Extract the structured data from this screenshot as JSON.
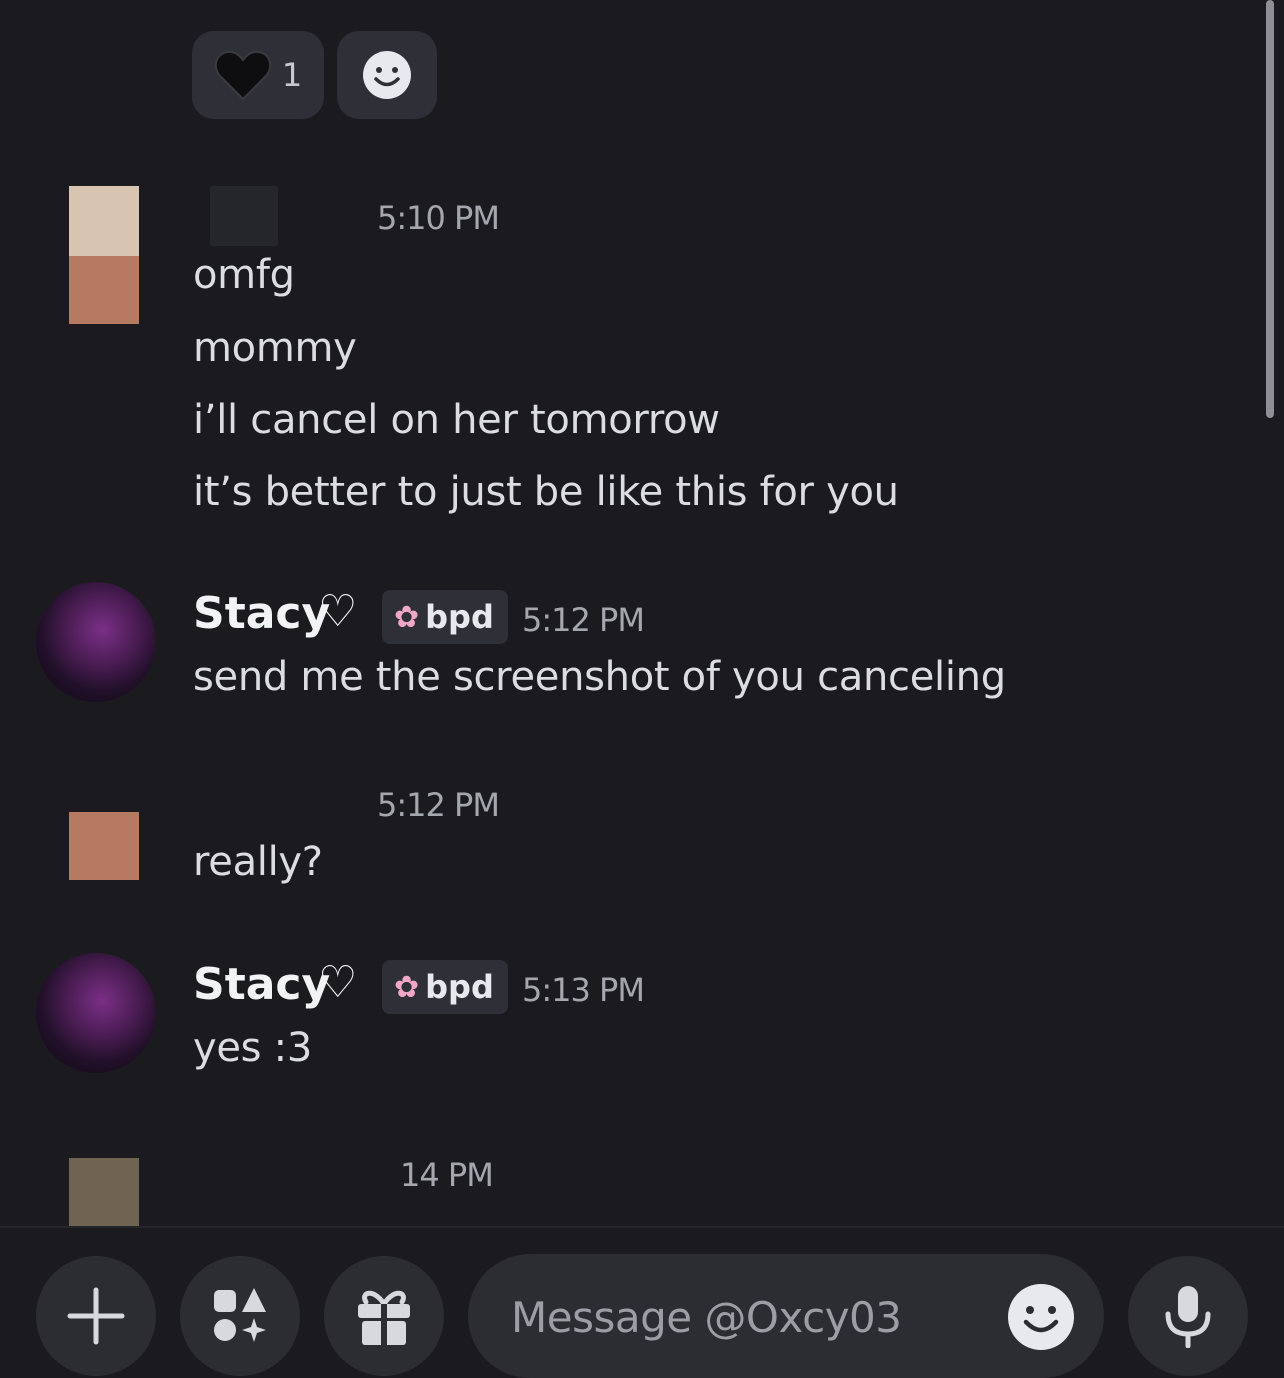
{
  "reactions": {
    "heart_count": "1"
  },
  "messages": [
    {
      "time": "5:10 PM",
      "lines": [
        "omfg",
        "mommy",
        "i’ll cancel on her tomorrow",
        "it’s better to just be like this for you"
      ]
    },
    {
      "username": "Stacy",
      "tag": "bpd",
      "time": "5:12 PM",
      "lines": [
        "send me the screenshot of you canceling"
      ]
    },
    {
      "time": "5:12 PM",
      "lines": [
        "really?"
      ]
    },
    {
      "username": "Stacy",
      "tag": "bpd",
      "time": "5:13 PM",
      "lines": [
        "yes :3"
      ]
    },
    {
      "time": "14 PM"
    }
  ],
  "composer": {
    "placeholder": "Message @Oxcy03"
  },
  "icons": [
    "black-heart-icon",
    "add-reaction-icon",
    "heart-outline-icon",
    "cherry-blossom-icon",
    "plus-icon",
    "apps-icon",
    "gift-icon",
    "emoji-icon",
    "microphone-icon"
  ],
  "colors": {
    "background": "#1a1a1f",
    "pill": "#2f3037",
    "text": "#dcdde2",
    "muted": "#a5a7ae"
  }
}
